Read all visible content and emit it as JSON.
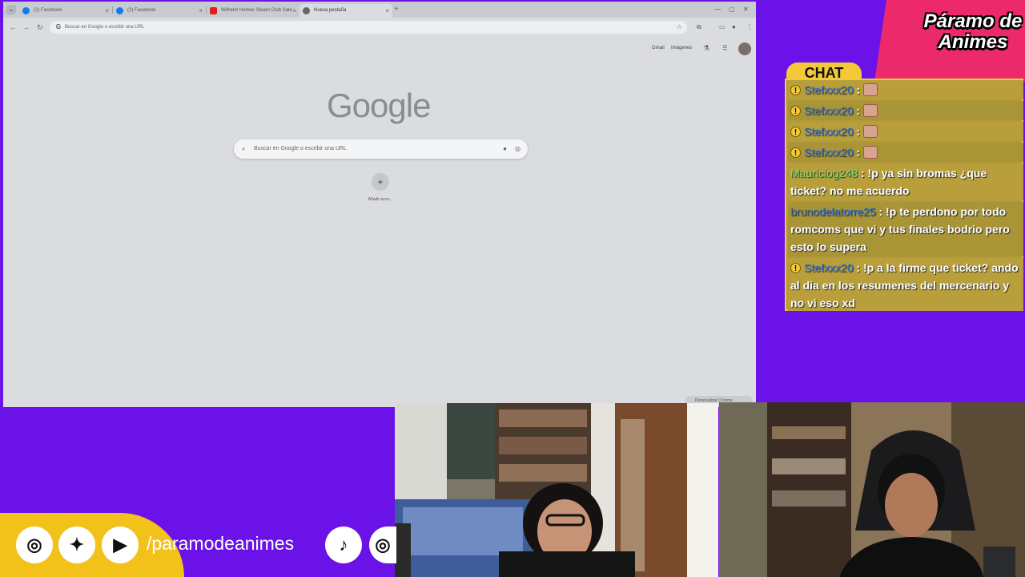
{
  "browser": {
    "tabs": [
      {
        "label": "(2) Facebook",
        "color": "#1877f2"
      },
      {
        "label": "(2) Facebook",
        "color": "#1877f2"
      },
      {
        "label": "Wilhelm Homes Steam Club Sale",
        "color": "#e02020"
      },
      {
        "label": "Nueva pestaña",
        "color": "#666666",
        "active": true
      }
    ],
    "new_tab": "+",
    "omnibox_placeholder": "Buscar en Google o escribir una URL",
    "page": {
      "gmail": "Gmail",
      "images": "Imágenes",
      "logo": "Google",
      "search_placeholder": "Buscar en Google o escribir una URL",
      "shortcut_label": "Añadir acce...",
      "customize": "Personalizar Chrome"
    }
  },
  "overlay": {
    "brand": "Páramo de Animes",
    "chat_title": "CHAT",
    "messages": [
      {
        "user": "Stefxxx20",
        "text": "",
        "badge": true,
        "emote": true
      },
      {
        "user": "Stefxxx20",
        "text": "",
        "badge": true,
        "emote": true
      },
      {
        "user": "Stefxxx20",
        "text": "",
        "badge": true,
        "emote": true
      },
      {
        "user": "Stefxxx20",
        "text": "",
        "badge": true,
        "emote": true
      },
      {
        "user": "Mauriciog248",
        "text": "!p ya sin bromas ¿que ticket? no me acuerdo",
        "badge": false
      },
      {
        "user": "brunodelatorre25",
        "text": "!p te perdono por todo romcoms que vi y tus finales bodrio pero esto lo supera",
        "badge": false
      },
      {
        "user": "Stefxxx20",
        "text": "!p a la firme que ticket? ando al dia en los resumenes del mercenario y no vi eso xd",
        "badge": true
      }
    ],
    "socials_handle": "/paramodeanimes",
    "colors": {
      "purple": "#6a12e8",
      "pink": "#ec2a6b",
      "yellow": "#f3c93a"
    }
  }
}
